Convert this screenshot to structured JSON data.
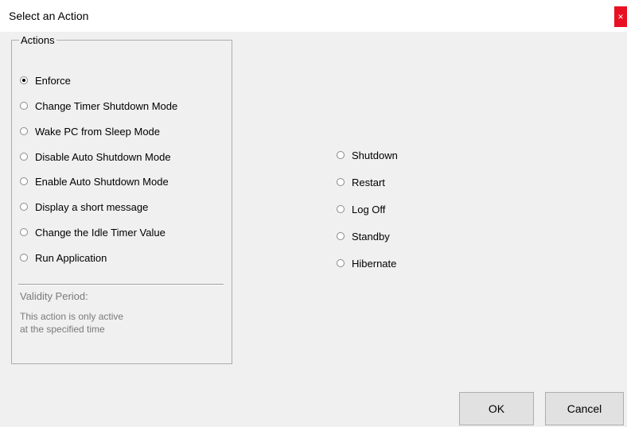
{
  "window": {
    "title": "Select an Action",
    "close_glyph": "×",
    "close_color": "#e81123"
  },
  "actions_group": {
    "label": "Actions",
    "options": [
      {
        "label": "Enforce",
        "checked": true
      },
      {
        "label": "Change Timer Shutdown Mode",
        "checked": false
      },
      {
        "label": "Wake PC from Sleep Mode",
        "checked": false
      },
      {
        "label": "Disable Auto Shutdown Mode",
        "checked": false
      },
      {
        "label": "Enable Auto Shutdown Mode",
        "checked": false
      },
      {
        "label": "Display a short message",
        "checked": false
      },
      {
        "label": "Change the Idle Timer Value",
        "checked": false
      },
      {
        "label": "Run Application",
        "checked": false
      }
    ],
    "validity_title": "Validity Period:",
    "validity_line1": "This action is only active",
    "validity_line2": "at the specified time"
  },
  "enforce_options": [
    {
      "label": "Shutdown",
      "checked": false
    },
    {
      "label": "Restart",
      "checked": false
    },
    {
      "label": "Log Off",
      "checked": false
    },
    {
      "label": "Standby",
      "checked": false
    },
    {
      "label": "Hibernate",
      "checked": false
    }
  ],
  "buttons": {
    "ok": "OK",
    "cancel": "Cancel"
  }
}
